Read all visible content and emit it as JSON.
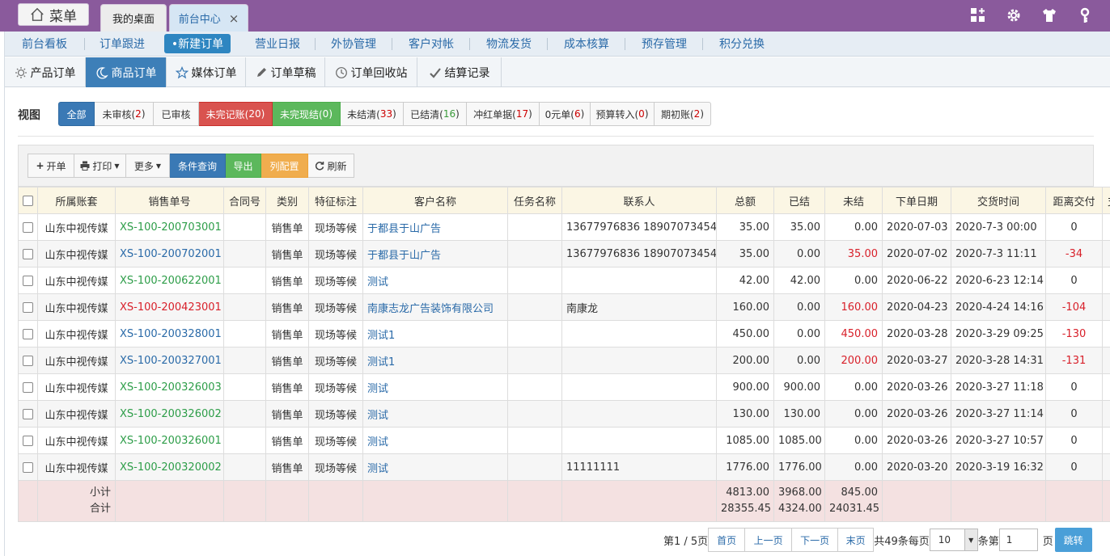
{
  "topbar": {
    "menu_label": "菜单",
    "tabs": [
      {
        "label": "我的桌面"
      },
      {
        "label": "前台中心",
        "close": "×"
      }
    ],
    "icons": [
      "apps-icon",
      "gear-icon",
      "shirt-icon",
      "key-icon"
    ]
  },
  "nav": {
    "items": [
      "前台看板",
      "订单跟进",
      "•新建订单",
      "营业日报",
      "外协管理",
      "客户对帐",
      "物流发货",
      "成本核算",
      "预存管理",
      "积分兑换"
    ]
  },
  "subtabs": [
    "产品订单",
    "商品订单",
    "媒体订单",
    "订单草稿",
    "订单回收站",
    "结算记录"
  ],
  "view": {
    "label": "视图",
    "filters": [
      {
        "label": "全部",
        "count": ""
      },
      {
        "label": "未审核(",
        "count": "2",
        "close": ")"
      },
      {
        "label": "已审核",
        "count": ""
      },
      {
        "label": "未完记账(",
        "count": "20",
        "close": ")"
      },
      {
        "label": "未完现结(",
        "count": "0",
        "close": ")"
      },
      {
        "label": "未结清(",
        "count": "33",
        "close": ")"
      },
      {
        "label": "已结清(",
        "count": "16",
        "close": ")"
      },
      {
        "label": "冲红单据(",
        "count": "17",
        "close": ")"
      },
      {
        "label": "0元单(",
        "count": "6",
        "close": ")"
      },
      {
        "label": "预算转入(",
        "count": "0",
        "close": ")"
      },
      {
        "label": "期初账(",
        "count": "2",
        "close": ")"
      }
    ]
  },
  "toolbar": {
    "new": "开单",
    "print": "打印",
    "more": "更多",
    "query": "条件查询",
    "export": "导出",
    "columns": "列配置",
    "refresh": "刷新"
  },
  "table": {
    "headers": [
      "所属账套",
      "销售单号",
      "合同号",
      "类别",
      "特征标注",
      "客户名称",
      "任务名称",
      "联系人",
      "总额",
      "已结",
      "未结",
      "下单日期",
      "交货时间",
      "距离交付",
      "支"
    ],
    "rows": [
      {
        "account": "山东中视传媒",
        "order_no": "XS-100-200703001",
        "order_color": "green",
        "contract": "",
        "category": "销售单",
        "tag": "现场等候",
        "customer": "于都县于山广告",
        "task": "",
        "contact": "13677976836 18907073454",
        "total": "35.00",
        "paid": "35.00",
        "unpaid": "0.00",
        "unpaid_red": false,
        "order_date": "2020-07-03",
        "delivery": "2020-7-3 00:00",
        "distance": "0",
        "distance_red": false
      },
      {
        "account": "山东中视传媒",
        "order_no": "XS-100-200702001",
        "order_color": "blue",
        "contract": "",
        "category": "销售单",
        "tag": "现场等候",
        "customer": "于都县于山广告",
        "task": "",
        "contact": "13677976836 18907073454",
        "total": "35.00",
        "paid": "0.00",
        "unpaid": "35.00",
        "unpaid_red": true,
        "order_date": "2020-07-02",
        "delivery": "2020-7-3 11:11",
        "distance": "-34",
        "distance_red": true
      },
      {
        "account": "山东中视传媒",
        "order_no": "XS-100-200622001",
        "order_color": "green",
        "contract": "",
        "category": "销售单",
        "tag": "现场等候",
        "customer": "测试",
        "task": "",
        "contact": "",
        "total": "42.00",
        "paid": "42.00",
        "unpaid": "0.00",
        "unpaid_red": false,
        "order_date": "2020-06-22",
        "delivery": "2020-6-23 12:14",
        "distance": "0",
        "distance_red": false
      },
      {
        "account": "山东中视传媒",
        "order_no": "XS-100-200423001",
        "order_color": "red",
        "contract": "",
        "category": "销售单",
        "tag": "现场等候",
        "customer": "南康志龙广告装饰有限公司",
        "task": "",
        "contact": "南康龙",
        "total": "160.00",
        "paid": "0.00",
        "unpaid": "160.00",
        "unpaid_red": true,
        "order_date": "2020-04-23",
        "delivery": "2020-4-24 14:16",
        "distance": "-104",
        "distance_red": true
      },
      {
        "account": "山东中视传媒",
        "order_no": "XS-100-200328001",
        "order_color": "blue",
        "contract": "",
        "category": "销售单",
        "tag": "现场等候",
        "customer": "测试1",
        "task": "",
        "contact": "",
        "total": "450.00",
        "paid": "0.00",
        "unpaid": "450.00",
        "unpaid_red": true,
        "order_date": "2020-03-28",
        "delivery": "2020-3-29 09:25",
        "distance": "-130",
        "distance_red": true
      },
      {
        "account": "山东中视传媒",
        "order_no": "XS-100-200327001",
        "order_color": "blue",
        "contract": "",
        "category": "销售单",
        "tag": "现场等候",
        "customer": "测试1",
        "task": "",
        "contact": "",
        "total": "200.00",
        "paid": "0.00",
        "unpaid": "200.00",
        "unpaid_red": true,
        "order_date": "2020-03-27",
        "delivery": "2020-3-28 14:31",
        "distance": "-131",
        "distance_red": true
      },
      {
        "account": "山东中视传媒",
        "order_no": "XS-100-200326003",
        "order_color": "green",
        "contract": "",
        "category": "销售单",
        "tag": "现场等候",
        "customer": "测试",
        "task": "",
        "contact": "",
        "total": "900.00",
        "paid": "900.00",
        "unpaid": "0.00",
        "unpaid_red": false,
        "order_date": "2020-03-26",
        "delivery": "2020-3-27 11:18",
        "distance": "0",
        "distance_red": false
      },
      {
        "account": "山东中视传媒",
        "order_no": "XS-100-200326002",
        "order_color": "green",
        "contract": "",
        "category": "销售单",
        "tag": "现场等候",
        "customer": "测试",
        "task": "",
        "contact": "",
        "total": "130.00",
        "paid": "130.00",
        "unpaid": "0.00",
        "unpaid_red": false,
        "order_date": "2020-03-26",
        "delivery": "2020-3-27 11:14",
        "distance": "0",
        "distance_red": false
      },
      {
        "account": "山东中视传媒",
        "order_no": "XS-100-200326001",
        "order_color": "green",
        "contract": "",
        "category": "销售单",
        "tag": "现场等候",
        "customer": "测试",
        "task": "",
        "contact": "",
        "total": "1085.00",
        "paid": "1085.00",
        "unpaid": "0.00",
        "unpaid_red": false,
        "order_date": "2020-03-26",
        "delivery": "2020-3-27 10:57",
        "distance": "0",
        "distance_red": false
      },
      {
        "account": "山东中视传媒",
        "order_no": "XS-100-200320002",
        "order_color": "green",
        "contract": "",
        "category": "销售单",
        "tag": "现场等候",
        "customer": "测试",
        "task": "",
        "contact": "11111111",
        "total": "1776.00",
        "paid": "1776.00",
        "unpaid": "0.00",
        "unpaid_red": false,
        "order_date": "2020-03-20",
        "delivery": "2020-3-19 16:32",
        "distance": "0",
        "distance_red": false
      }
    ],
    "subtotal": {
      "label": "小计",
      "total": "4813.00",
      "paid": "3968.00",
      "unpaid": "845.00"
    },
    "grandtotal": {
      "label": "合计",
      "total": "28355.45",
      "paid": "4324.00",
      "unpaid": "24031.45"
    }
  },
  "pager": {
    "page_info": "第1 / 5页",
    "first": "首页",
    "prev": "上一页",
    "next": "下一页",
    "last": "末页",
    "total_prefix": "共49条每页",
    "page_size": "10",
    "goto_prefix": "条第",
    "goto_value": "1",
    "goto_suffix": "页",
    "go": "跳转"
  }
}
